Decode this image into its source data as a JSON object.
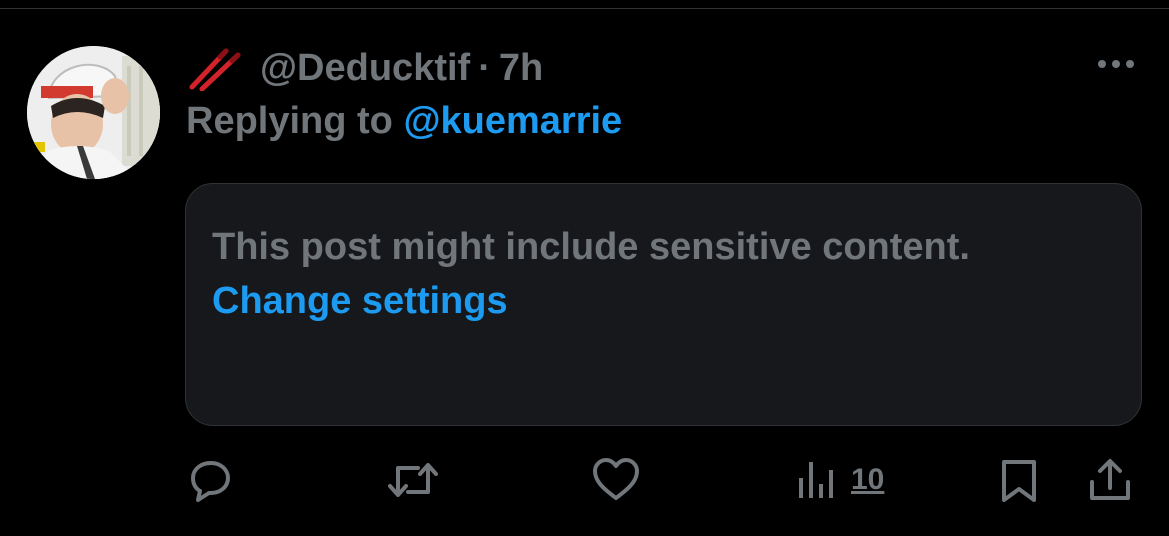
{
  "post": {
    "display_name_icon": "chopsticks-icon",
    "handle": "@Deducktif",
    "separator": "·",
    "time": "7h",
    "replying_prefix": "Replying to",
    "replying_handle": "@kuemarrie",
    "sensitive_notice": "This post might include sensitive content.",
    "change_settings_label": "Change settings"
  },
  "actions": {
    "reply_icon": "reply-icon",
    "repost_icon": "repost-icon",
    "like_icon": "heart-icon",
    "views_icon": "views-icon",
    "views_count": "10",
    "bookmark_icon": "bookmark-icon",
    "share_icon": "share-icon"
  },
  "colors": {
    "background": "#000000",
    "muted_text": "#71767b",
    "accent": "#1d9bf0",
    "card_background": "#16181c",
    "chopsticks": "#d2232a"
  }
}
